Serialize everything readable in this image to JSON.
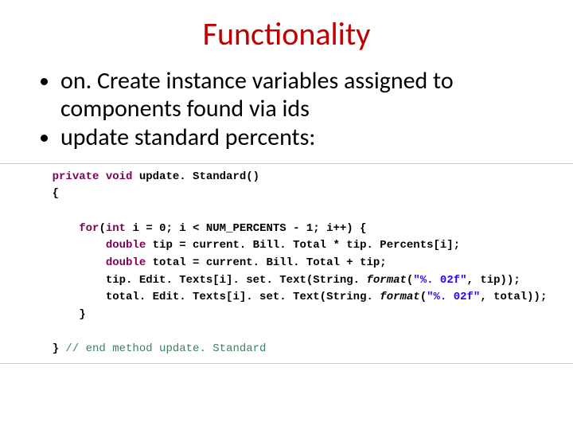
{
  "title": "Functionality",
  "bullets": [
    "on. Create instance variables assigned to components found via ids",
    "update standard percents:"
  ],
  "code": {
    "l1_kw1": "private",
    "l1_kw2": "void",
    "l1_name": " update. Standard()",
    "l2": "{",
    "l3_kw1": "for",
    "l3_open": "(",
    "l3_kw2": "int",
    "l3_rest": " i = 0; i < NUM_PERCENTS - 1; i++) {",
    "l4_kw": "double",
    "l4_rest": " tip = current. Bill. Total * tip. Percents[i];",
    "l5_kw": "double",
    "l5_rest": " total = current. Bill. Total + tip;",
    "l6_a": "tip. Edit. Texts[i]. set. Text(String. ",
    "l6_fn": "format",
    "l6_b": "(",
    "l6_str": "\"%. 02f\"",
    "l6_c": ", tip));",
    "l7_a": "total. Edit. Texts[i]. set. Text(String. ",
    "l7_fn": "format",
    "l7_b": "(",
    "l7_str": "\"%. 02f\"",
    "l7_c": ", total));",
    "l8": "}",
    "l9_brace": "} ",
    "l9_cmt": "// end method update. Standard"
  }
}
